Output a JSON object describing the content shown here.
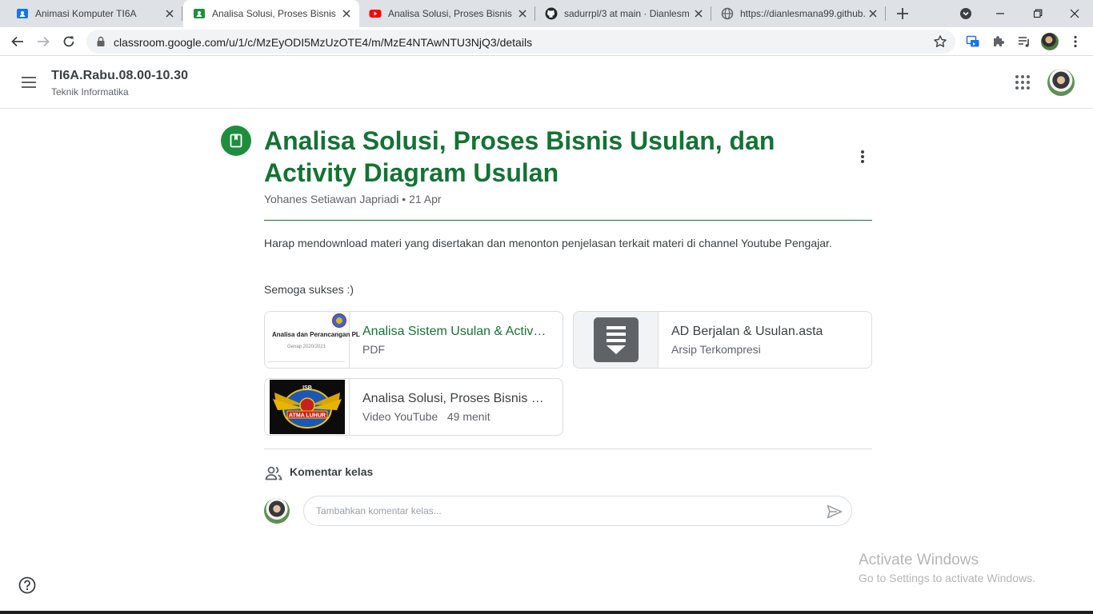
{
  "browser": {
    "tabs": [
      {
        "title": "Animasi Komputer TI6A",
        "icon": "classroom-icon",
        "active": false
      },
      {
        "title": "Analisa Solusi, Proses Bisnis U",
        "icon": "classroom-icon",
        "active": true
      },
      {
        "title": "Analisa Solusi, Proses Bisnis S",
        "icon": "youtube-icon",
        "active": false
      },
      {
        "title": "sadurrpl/3 at main · Dianlesm",
        "icon": "github-icon",
        "active": false
      },
      {
        "title": "https://dianlesmana99.github.",
        "icon": "globe-icon",
        "active": false
      }
    ],
    "url": "classroom.google.com/u/1/c/MzEyODI5MzUzOTE4/m/MzE4NTAwNTU3NjQ3/details"
  },
  "header": {
    "class_name": "TI6A.Rabu.08.00-10.30",
    "class_section": "Teknik Informatika"
  },
  "post": {
    "title": "Analisa Solusi, Proses Bisnis Usulan, dan Activity Diagram Usulan",
    "author": "Yohanes Setiawan Japriadi",
    "separator": "•",
    "date": "21 Apr",
    "description": "Harap mendownload materi yang disertakan dan menonton penjelasan terkait materi di channel Youtube Pengajar.",
    "closing": "Semoga sukses :)",
    "attachments": [
      {
        "name": "Analisa Sistem Usulan & Activity Diagram Usulan",
        "type": "PDF",
        "thumb_title": "Analisa dan Perancangan PL",
        "thumb_sub": "Genap 2020/2021"
      },
      {
        "name": "AD Berjalan & Usulan.asta",
        "type": "Arsip Terkompresi"
      },
      {
        "name": "Analisa Solusi, Proses Bisnis Usulan, dan Activity Diagram Usulan",
        "type": "Video YouTube",
        "duration": "49 menit",
        "thumb_top": "ISB",
        "thumb_banner": "ATMA LUHUR"
      }
    ]
  },
  "comments": {
    "label": "Komentar kelas",
    "placeholder": "Tambahkan komentar kelas..."
  },
  "watermark": {
    "line1": "Activate Windows",
    "line2": "Go to Settings to activate Windows."
  },
  "colors": {
    "accent": "#137333",
    "icon_bg": "#1e8e3e"
  }
}
